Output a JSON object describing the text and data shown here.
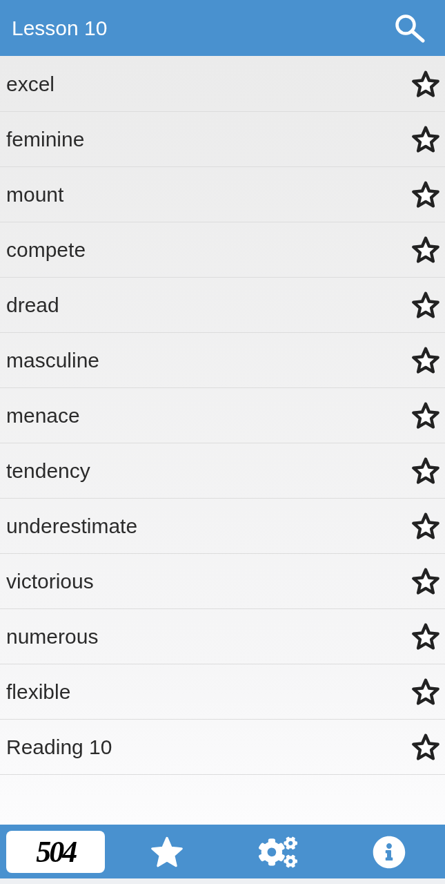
{
  "header": {
    "title": "Lesson 10"
  },
  "words": [
    {
      "text": "excel",
      "starred": false
    },
    {
      "text": "feminine",
      "starred": false
    },
    {
      "text": "mount",
      "starred": false
    },
    {
      "text": "compete",
      "starred": false
    },
    {
      "text": "dread",
      "starred": false
    },
    {
      "text": "masculine",
      "starred": false
    },
    {
      "text": "menace",
      "starred": false
    },
    {
      "text": "tendency",
      "starred": false
    },
    {
      "text": "underestimate",
      "starred": false
    },
    {
      "text": "victorious",
      "starred": false
    },
    {
      "text": "numerous",
      "starred": false
    },
    {
      "text": "flexible",
      "starred": false
    },
    {
      "text": "Reading 10",
      "starred": false
    }
  ],
  "bottom_nav": [
    {
      "label": "504",
      "selected": true
    },
    {
      "selected": false
    },
    {
      "selected": false
    },
    {
      "selected": false
    }
  ]
}
